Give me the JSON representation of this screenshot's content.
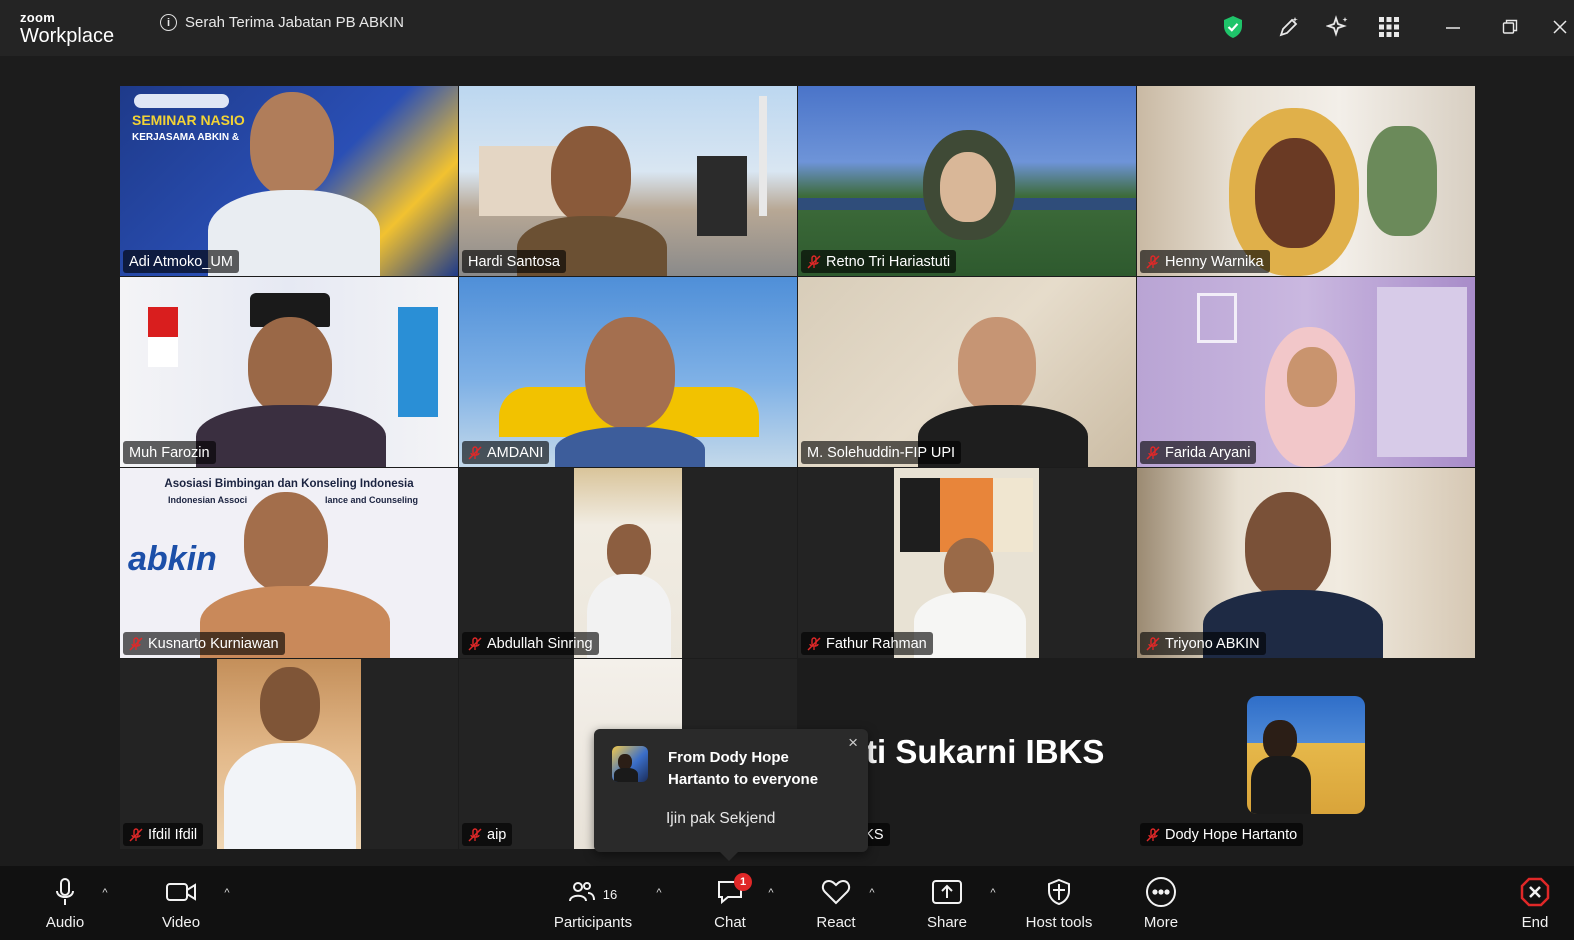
{
  "app": {
    "brand_small": "zoom",
    "brand_large": "Workplace"
  },
  "meeting": {
    "title": "Serah Terima Jabatan PB ABKIN"
  },
  "titlebar_icons": [
    "shield-check-icon",
    "edit-sparkle-icon",
    "ai-companion-icon",
    "apps-grid-icon",
    "minimize-icon",
    "restore-icon",
    "close-icon"
  ],
  "participants": [
    {
      "name": "Adi Atmoko_UM",
      "muted": false
    },
    {
      "name": "Hardi Santosa",
      "muted": false,
      "active_speaker": true
    },
    {
      "name": "Retno Tri Hariastuti",
      "muted": true
    },
    {
      "name": "Henny Warnika",
      "muted": true
    },
    {
      "name": "Muh Farozin",
      "muted": false
    },
    {
      "name": "AMDANI",
      "muted": true
    },
    {
      "name": "M. Solehuddin-FIP UPI",
      "muted": false
    },
    {
      "name": "Farida Aryani",
      "muted": true
    },
    {
      "name": "Kusnarto Kurniawan",
      "muted": true
    },
    {
      "name": "Abdullah Sinring",
      "muted": true
    },
    {
      "name": "Fathur Rahman",
      "muted": true
    },
    {
      "name": "Triyono ABKIN",
      "muted": true
    },
    {
      "name": "Ifdil Ifdil",
      "muted": true
    },
    {
      "name": "aip",
      "muted": true
    },
    {
      "name": "ukarni IBKS",
      "display_title": "ti Sukarni IBKS",
      "muted": false
    },
    {
      "name": "Dody Hope Hartanto",
      "muted": true
    }
  ],
  "backgrounds": {
    "seminar_banner": "SEMINAR NASIO",
    "seminar_sub": "KERJASAMA ABKIN &",
    "abkin_header_1": "Asosiasi Bimbingan dan Konseling Indonesia",
    "abkin_header_2": "Indonesian Associ",
    "abkin_header_3": "lance and Counseling",
    "abkin_logo": "abkin"
  },
  "chat_popup": {
    "from": "From Dody Hope Hartanto to everyone",
    "message": "Ijin pak Sekjend",
    "close": "×"
  },
  "toolbar": {
    "audio": "Audio",
    "video": "Video",
    "participants": "Participants",
    "participants_count": "16",
    "chat": "Chat",
    "chat_badge": "1",
    "react": "React",
    "share": "Share",
    "host_tools": "Host tools",
    "more": "More",
    "end": "End"
  },
  "colors": {
    "active_speaker": "#2ec27e",
    "titlebar": "#242424",
    "toolbar": "#111111",
    "muted_red": "#e02828",
    "shield_green": "#1fc46a"
  }
}
